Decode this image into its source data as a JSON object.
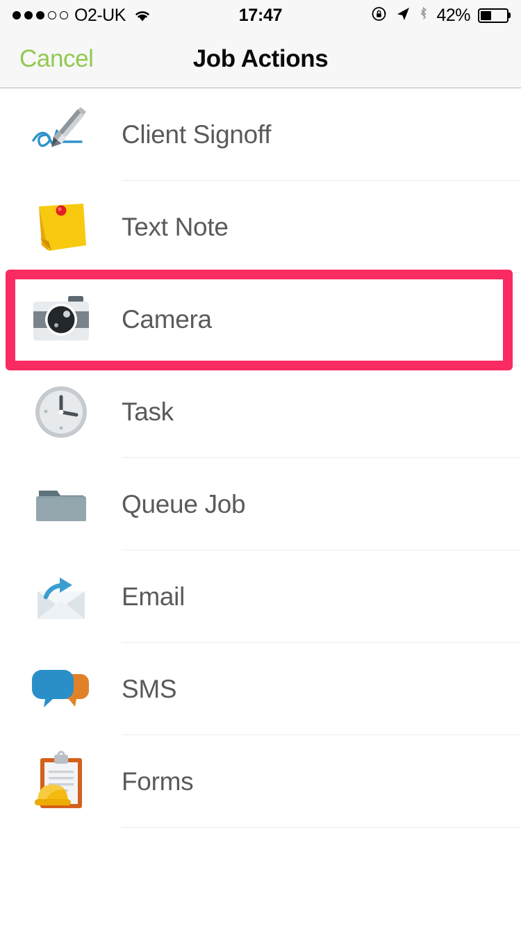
{
  "status_bar": {
    "carrier": "O2-UK",
    "signal_bars_filled": 3,
    "signal_bars_total": 5,
    "wifi_icon": "wifi-icon",
    "time": "17:47",
    "rotation_lock_icon": "rotation-lock-icon",
    "location_icon": "location-arrow-icon",
    "bluetooth_icon": "bluetooth-icon",
    "battery_percent": "42%",
    "battery_level": 42
  },
  "nav_bar": {
    "cancel_label": "Cancel",
    "title": "Job Actions",
    "cancel_color": "#92c94f"
  },
  "highlight": {
    "target": "Camera",
    "color": "#fa2a63"
  },
  "actions": [
    {
      "label": "Client Signoff",
      "icon": "pen-signature-icon"
    },
    {
      "label": "Text Note",
      "icon": "sticky-note-icon"
    },
    {
      "label": "Camera",
      "icon": "camera-icon"
    },
    {
      "label": "Task",
      "icon": "clock-icon"
    },
    {
      "label": "Queue Job",
      "icon": "folder-icon"
    },
    {
      "label": "Email",
      "icon": "envelope-forward-icon"
    },
    {
      "label": "SMS",
      "icon": "speech-bubbles-icon"
    },
    {
      "label": "Forms",
      "icon": "clipboard-hardhat-icon"
    }
  ]
}
